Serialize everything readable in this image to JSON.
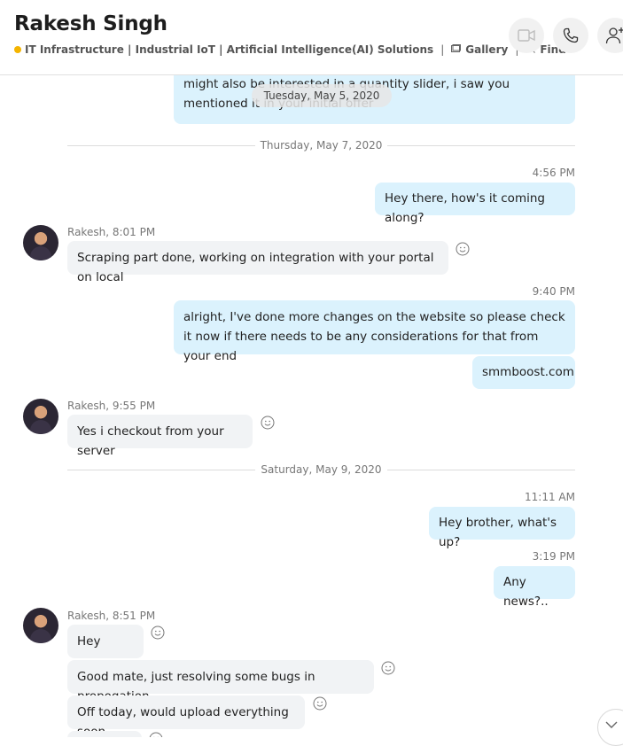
{
  "header": {
    "name": "Rakesh Singh",
    "headline": "IT Infrastructure | Industrial IoT | Artificial Intelligence(AI) Solutions",
    "separator": "|",
    "gallery_label": "Gallery",
    "find_label": "Find",
    "status_color": "#f4b400",
    "icons": [
      "video-call-icon",
      "audio-call-icon",
      "add-person-icon"
    ]
  },
  "floating_date": "Tuesday, May 5, 2020",
  "messages": {
    "m0": "might also be interested in a quantity slider, i saw you mentioned it in your initial offer",
    "sep1": "Thursday, May 7, 2020",
    "t1": "4:56 PM",
    "m1": "Hey there, how's it coming along?",
    "meta2": "Rakesh, 8:01 PM",
    "m2": "Scraping part done, working on integration with your portal on local",
    "t3": "9:40 PM",
    "m3": "alright, I've done more changes on the website so please check it now if there needs to be any considerations for that from your end",
    "m4": "smmboost.com",
    "meta5": "Rakesh, 9:55 PM",
    "m5": "Yes i checkout from your server",
    "sep2": "Saturday, May 9, 2020",
    "t6": "11:11 AM",
    "m6": "Hey brother, what's up?",
    "t7": "3:19 PM",
    "m7": "Any news?..",
    "meta8": "Rakesh, 8:51 PM",
    "m8": "Hey",
    "m9": "Good mate, just resolving some bugs in propogation",
    "m10": "Off today, would upload everything soon"
  },
  "colors": {
    "outgoing_bubble": "#dbf2fd",
    "incoming_bubble": "#f1f3f5"
  }
}
